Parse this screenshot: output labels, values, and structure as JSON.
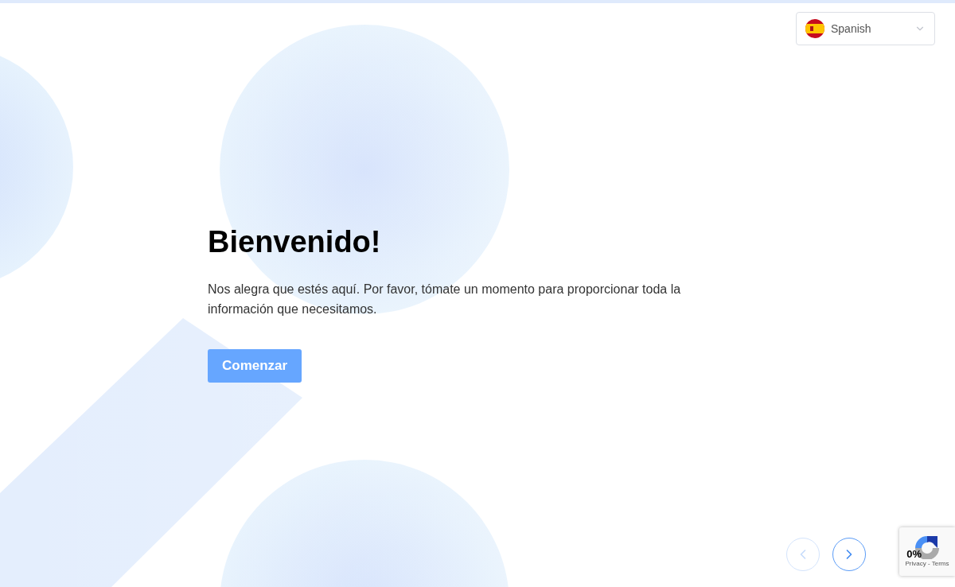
{
  "language_select": {
    "value": "Spanish"
  },
  "welcome": {
    "title": "Bienvenido!",
    "message": "Nos alegra que estés aquí. Por favor, tómate un momento para proporcionar toda la información que necesitamos.",
    "start_button": "Comenzar"
  },
  "navigation": [
    {
      "kind": "prev",
      "disabled": true
    },
    {
      "kind": "next",
      "disabled": false
    }
  ],
  "progress": {
    "label": "0%"
  },
  "recaptcha": {
    "links": "Privacy - Terms"
  }
}
